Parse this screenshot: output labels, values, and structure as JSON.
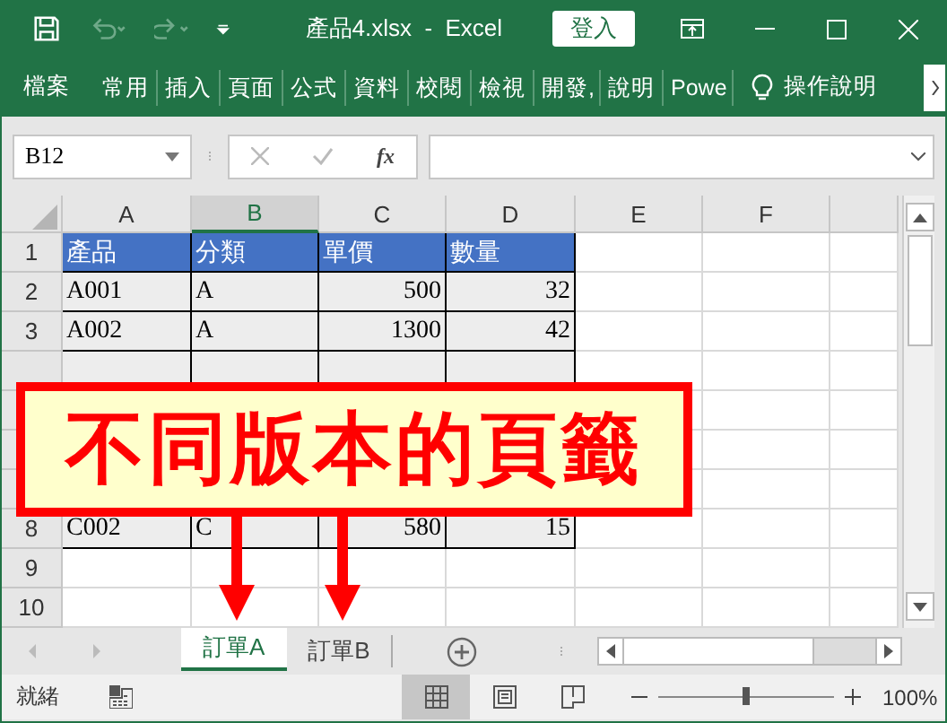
{
  "title_bar": {
    "title": "產品4.xlsx  -  Excel",
    "sign_in": "登入"
  },
  "ribbon": {
    "file_tab": "檔案",
    "tabs": [
      "常用",
      "插入",
      "頁面",
      "公式",
      "資料",
      "校閱",
      "檢視",
      "開發,",
      "說明",
      "Powe"
    ],
    "tell_me": "操作說明"
  },
  "formula_bar": {
    "name_box": "B12",
    "fx": "fx"
  },
  "columns": [
    {
      "label": "A",
      "selected": false
    },
    {
      "label": "B",
      "selected": true
    },
    {
      "label": "C",
      "selected": false
    },
    {
      "label": "D",
      "selected": false
    },
    {
      "label": "E",
      "selected": false
    },
    {
      "label": "F",
      "selected": false
    },
    {
      "selected": false
    }
  ],
  "rows": [
    {
      "number": "1",
      "kind": "header",
      "cells": [
        {
          "text": "產品",
          "kind": "text"
        },
        {
          "text": "分類",
          "kind": "text"
        },
        {
          "text": "單價",
          "kind": "text"
        },
        {
          "text": "數量",
          "kind": "text"
        }
      ]
    },
    {
      "number": "2",
      "kind": "data",
      "cells": [
        {
          "text": "A001",
          "kind": "text"
        },
        {
          "text": "A",
          "kind": "text"
        },
        {
          "text": "500",
          "kind": "number"
        },
        {
          "text": "32",
          "kind": "number"
        }
      ]
    },
    {
      "number": "3",
      "kind": "data",
      "cells": [
        {
          "text": "A002",
          "kind": "text"
        },
        {
          "text": "A",
          "kind": "text"
        },
        {
          "text": "1300",
          "kind": "number"
        },
        {
          "text": "42",
          "kind": "number"
        }
      ]
    },
    {
      "kind": "covered"
    },
    {
      "kind": "covered"
    },
    {
      "kind": "covered"
    },
    {
      "kind": "covered"
    },
    {
      "number": "8",
      "kind": "data",
      "cells": [
        {
          "text": "C002",
          "kind": "text"
        },
        {
          "text": "C",
          "kind": "text"
        },
        {
          "text": "580",
          "kind": "number"
        },
        {
          "text": "15",
          "kind": "number"
        }
      ]
    },
    {
      "number": "9",
      "kind": "empty"
    },
    {
      "number": "10",
      "kind": "empty"
    }
  ],
  "callout": {
    "text": "不同版本的頁籤"
  },
  "sheet_tabs": [
    {
      "label": "訂單A",
      "selected": true
    },
    {
      "label": "訂單B",
      "selected": false
    }
  ],
  "status_bar": {
    "status": "就緒",
    "views": [
      {
        "kind": "normal",
        "selected": true
      },
      {
        "kind": "page-layout",
        "selected": false
      },
      {
        "kind": "page-break",
        "selected": false
      }
    ],
    "zoom": {
      "level": 0.5,
      "reading": "100%"
    }
  }
}
